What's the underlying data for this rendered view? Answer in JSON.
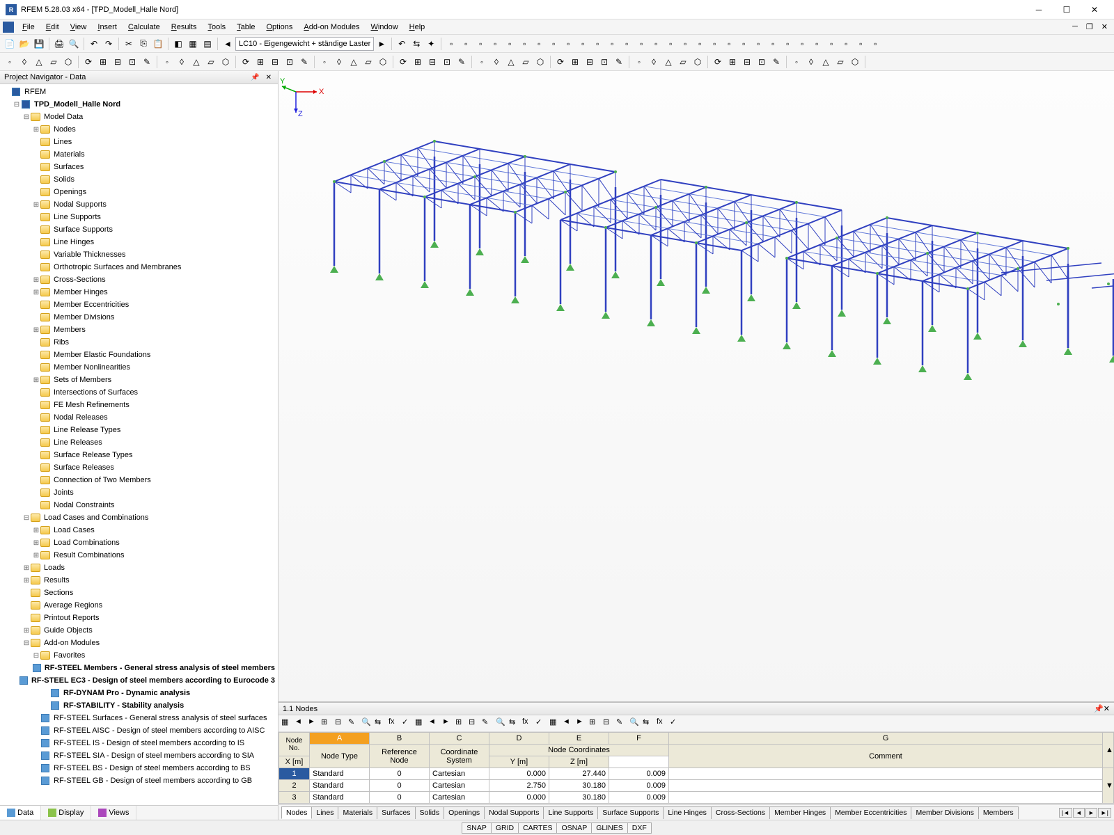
{
  "title": "RFEM 5.28.03 x64 - [TPD_Modell_Halle Nord]",
  "menu": [
    "File",
    "Edit",
    "View",
    "Insert",
    "Calculate",
    "Results",
    "Tools",
    "Table",
    "Options",
    "Add-on Modules",
    "Window",
    "Help"
  ],
  "loadcase": "LC10 - Eigengewicht + ständige Laster",
  "nav": {
    "title": "Project Navigator - Data",
    "root": "RFEM",
    "project": "TPD_Modell_Halle Nord",
    "model_data": "Model Data",
    "items": [
      "Nodes",
      "Lines",
      "Materials",
      "Surfaces",
      "Solids",
      "Openings",
      "Nodal Supports",
      "Line Supports",
      "Surface Supports",
      "Line Hinges",
      "Variable Thicknesses",
      "Orthotropic Surfaces and Membranes",
      "Cross-Sections",
      "Member Hinges",
      "Member Eccentricities",
      "Member Divisions",
      "Members",
      "Ribs",
      "Member Elastic Foundations",
      "Member Nonlinearities",
      "Sets of Members",
      "Intersections of Surfaces",
      "FE Mesh Refinements",
      "Nodal Releases",
      "Line Release Types",
      "Line Releases",
      "Surface Release Types",
      "Surface Releases",
      "Connection of Two Members",
      "Joints",
      "Nodal Constraints"
    ],
    "lcc": "Load Cases and Combinations",
    "lcc_items": [
      "Load Cases",
      "Load Combinations",
      "Result Combinations"
    ],
    "other": [
      "Loads",
      "Results",
      "Sections",
      "Average Regions",
      "Printout Reports",
      "Guide Objects"
    ],
    "addon": "Add-on Modules",
    "favorites": "Favorites",
    "fav_items": [
      "RF-STEEL Members - General stress analysis of steel members",
      "RF-STEEL EC3 - Design of steel members according to Eurocode 3",
      "RF-DYNAM Pro - Dynamic analysis",
      "RF-STABILITY - Stability analysis"
    ],
    "modules": [
      "RF-STEEL Surfaces - General stress analysis of steel surfaces",
      "RF-STEEL AISC - Design of steel members according to AISC",
      "RF-STEEL IS - Design of steel members according to IS",
      "RF-STEEL SIA - Design of steel members according to SIA",
      "RF-STEEL BS - Design of steel members according to BS",
      "RF-STEEL GB - Design of steel members according to GB"
    ],
    "tabs": [
      "Data",
      "Display",
      "Views"
    ]
  },
  "table": {
    "title": "1.1 Nodes",
    "headers": {
      "node_no": "Node No.",
      "node_type": "Node Type",
      "ref_node": "Reference Node",
      "coord_sys": "Coordinate System",
      "coords": "Node Coordinates",
      "x": "X [m]",
      "y": "Y [m]",
      "z": "Z [m]",
      "comment": "Comment"
    },
    "cols": [
      "A",
      "B",
      "C",
      "D",
      "E",
      "F",
      "G"
    ],
    "rows": [
      {
        "n": "1",
        "type": "Standard",
        "ref": "0",
        "sys": "Cartesian",
        "x": "0.000",
        "y": "27.440",
        "z": "0.009"
      },
      {
        "n": "2",
        "type": "Standard",
        "ref": "0",
        "sys": "Cartesian",
        "x": "2.750",
        "y": "30.180",
        "z": "0.009"
      },
      {
        "n": "3",
        "type": "Standard",
        "ref": "0",
        "sys": "Cartesian",
        "x": "0.000",
        "y": "30.180",
        "z": "0.009"
      }
    ]
  },
  "bottom_tabs": [
    "Nodes",
    "Lines",
    "Materials",
    "Surfaces",
    "Solids",
    "Openings",
    "Nodal Supports",
    "Line Supports",
    "Surface Supports",
    "Line Hinges",
    "Cross-Sections",
    "Member Hinges",
    "Member Eccentricities",
    "Member Divisions",
    "Members"
  ],
  "status": [
    "SNAP",
    "GRID",
    "CARTES",
    "OSNAP",
    "GLINES",
    "DXF"
  ],
  "axis": {
    "x": "X",
    "y": "Y",
    "z": "Z"
  }
}
